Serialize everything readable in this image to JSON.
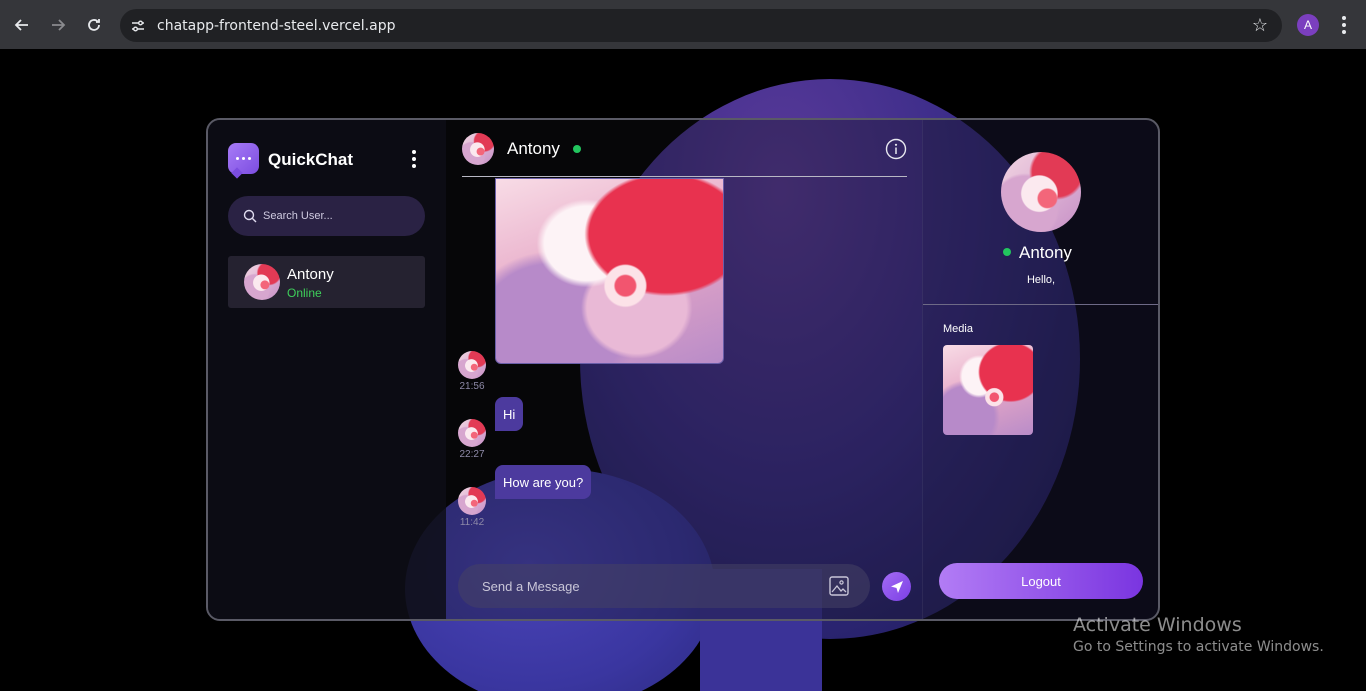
{
  "browser": {
    "url": "chatapp-frontend-steel.vercel.app",
    "profile_initial": "A",
    "profile_color": "#7b3fbf"
  },
  "sidebar": {
    "app_title": "QuickChat",
    "search_placeholder": "Search User...",
    "contacts": [
      {
        "name": "Antony",
        "status": "Online"
      }
    ]
  },
  "chat": {
    "header_name": "Antony",
    "status_color": "#22c55e",
    "messages": [
      {
        "type": "image",
        "time": "21:56"
      },
      {
        "type": "text",
        "text": "Hi",
        "time": "22:27"
      },
      {
        "type": "text",
        "text": "How are you?",
        "time": "11:42"
      }
    ],
    "composer_placeholder": "Send a Message"
  },
  "profile_panel": {
    "name": "Antony",
    "bio": "Hello,",
    "media_label": "Media",
    "logout_label": "Logout"
  },
  "watermark": {
    "title": "Activate Windows",
    "subtitle": "Go to Settings to activate Windows."
  },
  "colors": {
    "accent": "#8b5cf6",
    "bubble": "#4c3a9e",
    "online": "#22c55e"
  }
}
